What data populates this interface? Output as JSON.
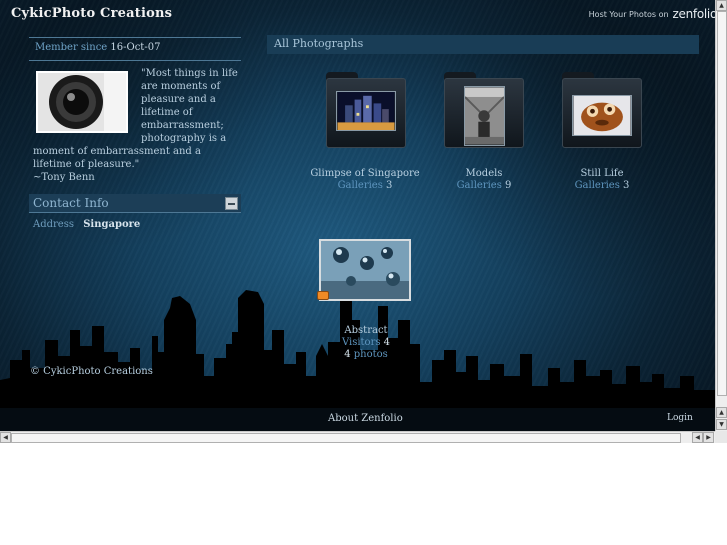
{
  "header": {
    "site_title": "CykicPhoto Creations",
    "host_text": "Host Your Photos on",
    "host_brand": "zenfolio"
  },
  "profile": {
    "member_label": "Member since",
    "member_date": "16-Oct-07",
    "quote": "\"Most things in life are moments of pleasure and a lifetime of embarrassment; photography is a moment of embarrassment and a lifetime of pleasure.\"",
    "quote_author": "~Tony Benn"
  },
  "contact": {
    "title": "Contact Info",
    "address_label": "Address",
    "address_value": "Singapore"
  },
  "main": {
    "section_title": "All Photographs",
    "galleries": [
      {
        "name": "Glimpse of Singapore",
        "count_label": "Galleries",
        "count": "3",
        "icon": "folder-icon"
      },
      {
        "name": "Models",
        "count_label": "Galleries",
        "count": "9",
        "icon": "folder-icon"
      },
      {
        "name": "Still Life",
        "count_label": "Galleries",
        "count": "3",
        "icon": "folder-icon"
      }
    ],
    "photo_set": {
      "name": "Abstract",
      "visitors_label": "Visitors",
      "visitors": "4",
      "photos_count": "4",
      "photos_label": "photos",
      "icon": "rss-icon"
    }
  },
  "footer": {
    "copyright": "© CykicPhoto Creations",
    "about": "About Zenfolio",
    "login": "Login"
  },
  "colors": {
    "background": "#14405e",
    "link": "#5e95be",
    "text": "#b7cfe0"
  }
}
